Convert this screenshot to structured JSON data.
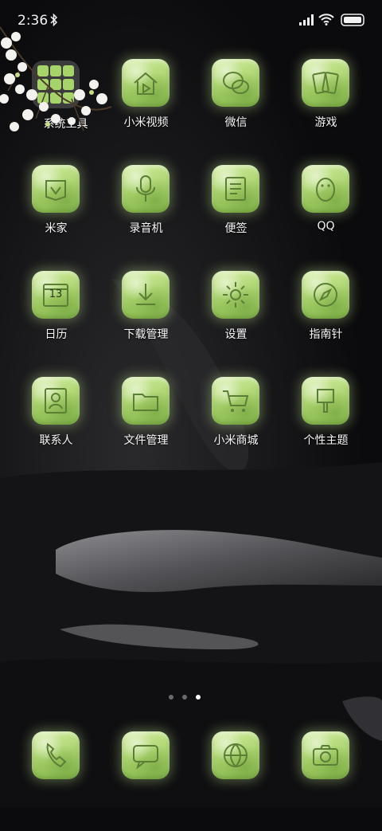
{
  "status_bar": {
    "time": "2:36",
    "bluetooth_icon": "bluetooth-icon",
    "signal_icon": "cell-signal-icon",
    "wifi_icon": "wifi-icon",
    "battery_icon": "battery-icon"
  },
  "theme": {
    "jade": "#a9d36e",
    "label": "#f5f5f5",
    "background": "#0b0b0d"
  },
  "folder": {
    "label": "系统工具",
    "icon": "folder-icon"
  },
  "apps": [
    {
      "label": "小米视频",
      "icon": "video-house-icon"
    },
    {
      "label": "微信",
      "icon": "wechat-icon"
    },
    {
      "label": "游戏",
      "icon": "cards-icon"
    },
    {
      "label": "米家",
      "icon": "mijia-icon"
    },
    {
      "label": "录音机",
      "icon": "microphone-icon"
    },
    {
      "label": "便签",
      "icon": "notes-icon"
    },
    {
      "label": "QQ",
      "icon": "penguin-icon"
    },
    {
      "label": "日历",
      "icon": "calendar-icon",
      "day": "13"
    },
    {
      "label": "下载管理",
      "icon": "download-icon"
    },
    {
      "label": "设置",
      "icon": "settings-icon"
    },
    {
      "label": "指南针",
      "icon": "compass-icon"
    },
    {
      "label": "联系人",
      "icon": "contacts-icon"
    },
    {
      "label": "文件管理",
      "icon": "file-manager-icon"
    },
    {
      "label": "小米商城",
      "icon": "shopping-cart-icon"
    },
    {
      "label": "个性主题",
      "icon": "theme-icon"
    }
  ],
  "page_indicator": {
    "pages": 3,
    "current": 3
  },
  "dock": [
    {
      "icon": "phone-icon"
    },
    {
      "icon": "messages-icon"
    },
    {
      "icon": "browser-icon"
    },
    {
      "icon": "camera-icon"
    }
  ]
}
